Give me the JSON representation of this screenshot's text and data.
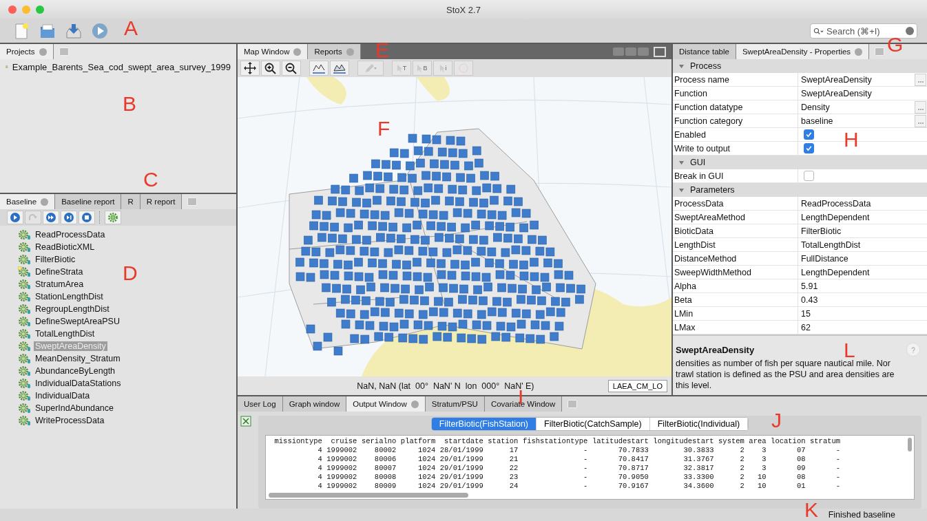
{
  "window": {
    "title": "StoX 2.7"
  },
  "toolbar": {
    "buttons": [
      {
        "kind": "new"
      },
      {
        "kind": "open"
      },
      {
        "kind": "save"
      },
      {
        "kind": "run"
      }
    ],
    "search": {
      "placeholder": "Search (⌘+I)"
    }
  },
  "projects_panel": {
    "tab": "Projects",
    "items": [
      "Example_Barents_Sea_cod_swept_area_survey_1999"
    ]
  },
  "process_panel": {
    "tabs": [
      {
        "label": "Baseline",
        "selected": true
      },
      {
        "label": "Baseline report",
        "selected": false
      },
      {
        "label": "R",
        "selected": false
      },
      {
        "label": "R report",
        "selected": false
      }
    ],
    "tools": [
      {
        "kind": "run",
        "disabled": false
      },
      {
        "kind": "redo",
        "disabled": true
      },
      {
        "kind": "fast-forward",
        "disabled": false
      },
      {
        "kind": "step",
        "disabled": false
      },
      {
        "kind": "stop",
        "disabled": false
      },
      {
        "kind": "gear",
        "disabled": false
      }
    ],
    "processes": [
      {
        "name": "ReadProcessData",
        "selected": false,
        "flagged": false
      },
      {
        "name": "ReadBioticXML",
        "selected": false,
        "flagged": false
      },
      {
        "name": "FilterBiotic",
        "selected": false,
        "flagged": false
      },
      {
        "name": "DefineStrata",
        "selected": false,
        "flagged": true
      },
      {
        "name": "StratumArea",
        "selected": false,
        "flagged": false
      },
      {
        "name": "StationLengthDist",
        "selected": false,
        "flagged": false
      },
      {
        "name": "RegroupLengthDist",
        "selected": false,
        "flagged": false
      },
      {
        "name": "DefineSweptAreaPSU",
        "selected": false,
        "flagged": false
      },
      {
        "name": "TotalLengthDist",
        "selected": false,
        "flagged": false
      },
      {
        "name": "SweptAreaDensity",
        "selected": true,
        "flagged": false
      },
      {
        "name": "MeanDensity_Stratum",
        "selected": false,
        "flagged": false
      },
      {
        "name": "AbundanceByLength",
        "selected": false,
        "flagged": false
      },
      {
        "name": "IndividualDataStations",
        "selected": false,
        "flagged": false
      },
      {
        "name": "IndividualData",
        "selected": false,
        "flagged": false
      },
      {
        "name": "SuperIndAbundance",
        "selected": false,
        "flagged": false
      },
      {
        "name": "WriteProcessData",
        "selected": false,
        "flagged": false
      }
    ]
  },
  "map_panel": {
    "tabs": [
      {
        "label": "Map Window",
        "selected": true
      },
      {
        "label": "Reports",
        "selected": false
      }
    ],
    "tools": [
      {
        "kind": "pan",
        "disabled": false
      },
      {
        "kind": "zoom-in",
        "disabled": false
      },
      {
        "kind": "zoom-out",
        "disabled": false
      },
      {
        "kind": "chart",
        "disabled": false
      },
      {
        "kind": "chart-filled",
        "disabled": false
      },
      {
        "kind": "pencil",
        "disabled": true
      },
      {
        "kind": "pick",
        "label": "T",
        "disabled": true
      },
      {
        "kind": "pick",
        "label": "B",
        "disabled": true
      },
      {
        "kind": "pick",
        "label": "i",
        "disabled": true
      },
      {
        "kind": "circle",
        "disabled": true
      }
    ],
    "coordinates": "NaN, NaN (lat  00°  NaN' N  lon  000°  NaN' E)",
    "projection": "LAEA_CM_LO"
  },
  "properties_panel": {
    "tabs": [
      {
        "label": "Distance table",
        "selected": false
      },
      {
        "label": "SweptAreaDensity - Properties",
        "selected": true
      }
    ],
    "sections": [
      {
        "title": "Process",
        "rows": [
          {
            "name": "Process name",
            "kind": "text",
            "value": "SweptAreaDensity",
            "has_button": true
          },
          {
            "name": "Function",
            "kind": "text",
            "value": "SweptAreaDensity",
            "has_button": false
          },
          {
            "name": "Function datatype",
            "kind": "text",
            "value": "Density",
            "has_button": true
          },
          {
            "name": "Function category",
            "kind": "text",
            "value": "baseline",
            "has_button": true
          },
          {
            "name": "Enabled",
            "kind": "checkbox",
            "checked": true
          },
          {
            "name": "Write to output",
            "kind": "checkbox",
            "checked": true
          }
        ]
      },
      {
        "title": "GUI",
        "rows": [
          {
            "name": "Break in GUI",
            "kind": "checkbox",
            "checked": false
          }
        ]
      },
      {
        "title": "Parameters",
        "rows": [
          {
            "name": "ProcessData",
            "kind": "text",
            "value": "ReadProcessData",
            "has_button": false
          },
          {
            "name": "SweptAreaMethod",
            "kind": "text",
            "value": "LengthDependent",
            "has_button": false
          },
          {
            "name": "BioticData",
            "kind": "text",
            "value": "FilterBiotic",
            "has_button": false
          },
          {
            "name": "LengthDist",
            "kind": "text",
            "value": "TotalLengthDist",
            "has_button": false
          },
          {
            "name": "DistanceMethod",
            "kind": "text",
            "value": "FullDistance",
            "has_button": false
          },
          {
            "name": "SweepWidthMethod",
            "kind": "text",
            "value": "LengthDependent",
            "has_button": false
          },
          {
            "name": "Alpha",
            "kind": "text",
            "value": "5.91",
            "has_button": false
          },
          {
            "name": "Beta",
            "kind": "text",
            "value": "0.43",
            "has_button": false
          },
          {
            "name": "LMin",
            "kind": "text",
            "value": "15",
            "has_button": false
          },
          {
            "name": "LMax",
            "kind": "text",
            "value": "62",
            "has_button": false
          }
        ]
      }
    ],
    "description": {
      "title": "SweptAreaDensity",
      "lines": [
        "densities as number of fish per square nautical mile. Nor",
        "trawl station is defined as the PSU and area densities are",
        "this level."
      ]
    }
  },
  "output_panel": {
    "tabs": [
      {
        "label": "User Log",
        "selected": false,
        "closable": false
      },
      {
        "label": "Graph window",
        "selected": false,
        "closable": false
      },
      {
        "label": "Output Window",
        "selected": true,
        "closable": true
      },
      {
        "label": "Stratum/PSU",
        "selected": false,
        "closable": false
      },
      {
        "label": "Covariate Window",
        "selected": false,
        "closable": false
      }
    ],
    "segments": [
      {
        "label": "FilterBiotic(FishStation)",
        "selected": true
      },
      {
        "label": "FilterBiotic(CatchSample)",
        "selected": false
      },
      {
        "label": "FilterBiotic(Individual)",
        "selected": false
      }
    ],
    "columns": [
      "missiontype",
      "cruise",
      "serialno",
      "platform",
      "startdate",
      "station",
      "fishstationtype",
      "latitudestart",
      "longitudestart",
      "system",
      "area",
      "location",
      "stratum"
    ],
    "rows": [
      [
        "4",
        "1999002",
        "80002",
        "1024",
        "28/01/1999",
        "17",
        "-",
        "70.7833",
        "30.3833",
        "2",
        "3",
        "07",
        "-"
      ],
      [
        "4",
        "1999002",
        "80006",
        "1024",
        "29/01/1999",
        "21",
        "-",
        "70.8417",
        "31.3767",
        "2",
        "3",
        "08",
        "-"
      ],
      [
        "4",
        "1999002",
        "80007",
        "1024",
        "29/01/1999",
        "22",
        "-",
        "70.8717",
        "32.3817",
        "2",
        "3",
        "09",
        "-"
      ],
      [
        "4",
        "1999002",
        "80008",
        "1024",
        "29/01/1999",
        "23",
        "-",
        "70.9050",
        "33.3300",
        "2",
        "10",
        "08",
        "-"
      ],
      [
        "4",
        "1999002",
        "80009",
        "1024",
        "29/01/1999",
        "24",
        "-",
        "70.9167",
        "34.3600",
        "2",
        "10",
        "01",
        "-"
      ]
    ]
  },
  "status_bar": {
    "message": "Finished baseline"
  },
  "callouts": [
    "A",
    "B",
    "C",
    "D",
    "E",
    "F",
    "G",
    "H",
    "I",
    "J",
    "K",
    "L"
  ]
}
